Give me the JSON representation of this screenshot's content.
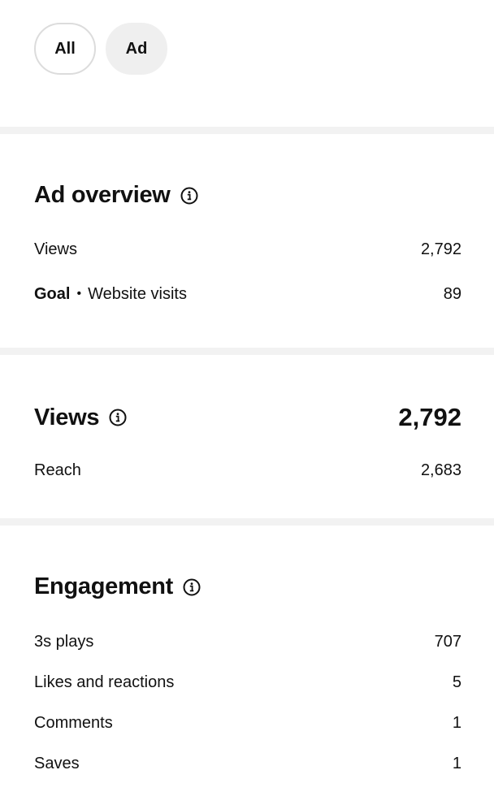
{
  "filters": {
    "all_label": "All",
    "ad_label": "Ad"
  },
  "ad_overview": {
    "title": "Ad overview",
    "rows": [
      {
        "label": "Views",
        "value": "2,792"
      },
      {
        "label_bold": "Goal",
        "label_separator": "•",
        "label_rest": "Website visits",
        "value": "89"
      }
    ]
  },
  "views": {
    "title": "Views",
    "total": "2,792",
    "rows": [
      {
        "label": "Reach",
        "value": "2,683"
      }
    ]
  },
  "engagement": {
    "title": "Engagement",
    "rows": [
      {
        "label": "3s plays",
        "value": "707"
      },
      {
        "label": "Likes and reactions",
        "value": "5"
      },
      {
        "label": "Comments",
        "value": "1"
      },
      {
        "label": "Saves",
        "value": "1"
      }
    ]
  },
  "icons": {
    "info": "info-circle-icon"
  },
  "colors": {
    "text": "#111111",
    "divider": "#f2f2f2",
    "chip_selected_bg": "#efefef",
    "chip_border": "#dcdcdc"
  }
}
